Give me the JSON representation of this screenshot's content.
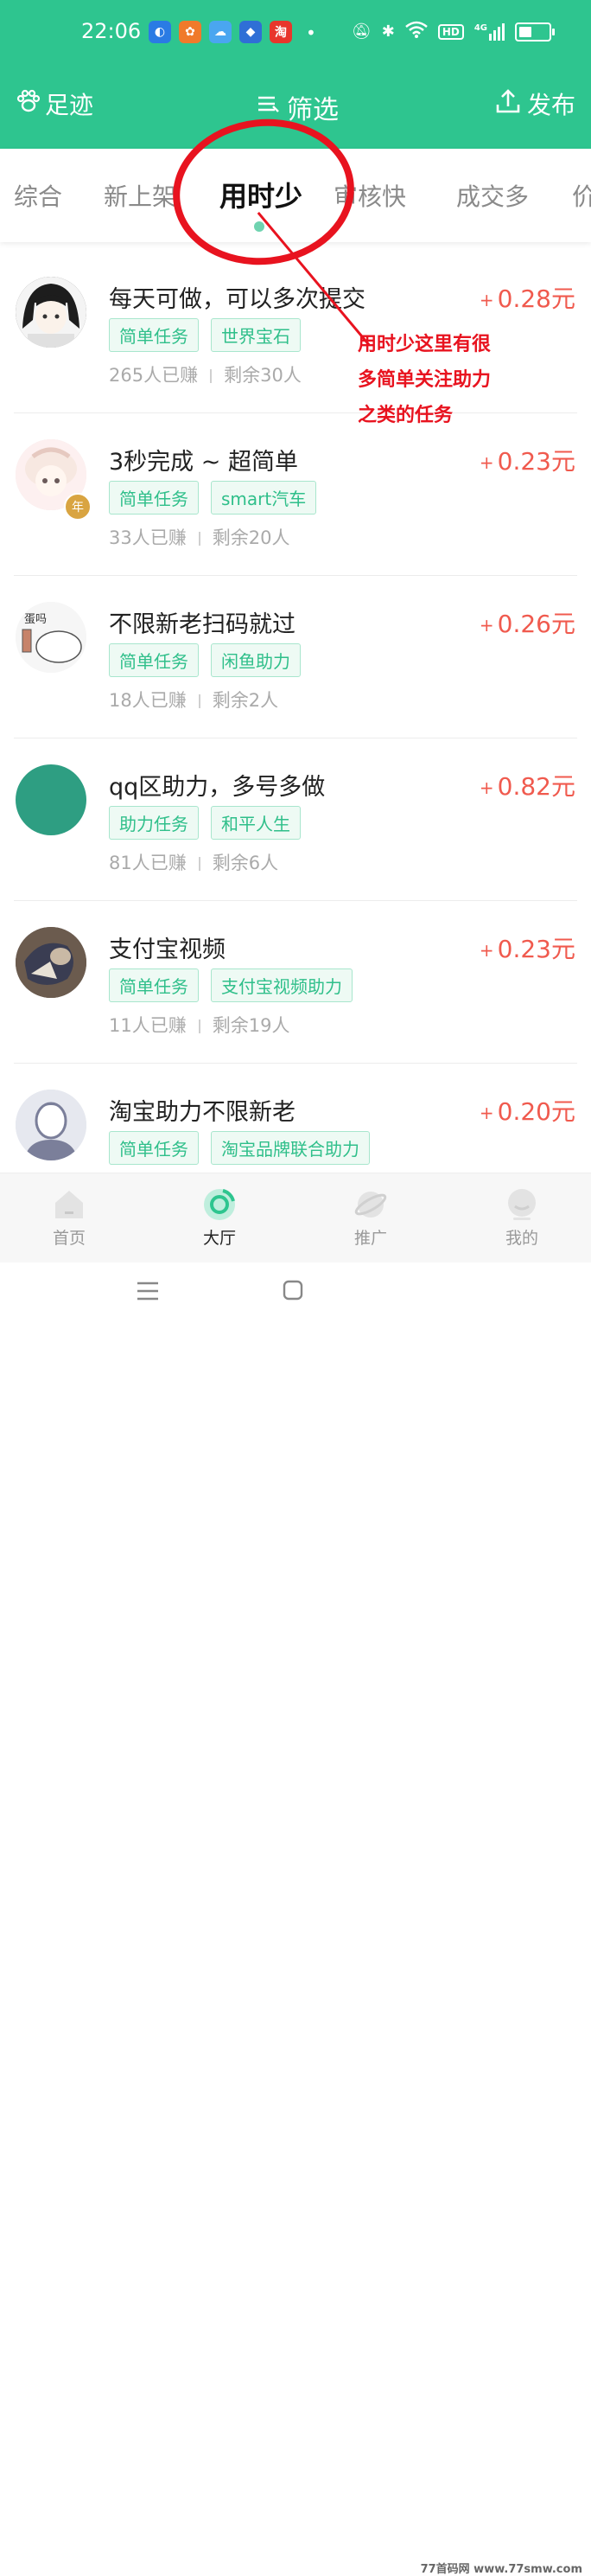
{
  "status_bar": {
    "time": "22:06",
    "app_icons": [
      {
        "name": "browser-app-icon",
        "glyph": "◐",
        "color": "#2a7be4"
      },
      {
        "name": "app2-icon",
        "glyph": "✿",
        "color": "#f07a2b"
      },
      {
        "name": "weather-app-icon",
        "glyph": "☁",
        "color": "#4aa6f0"
      },
      {
        "name": "app4-icon",
        "glyph": "◆",
        "color": "#2f6fd6"
      },
      {
        "name": "taobao-app-icon",
        "glyph": "淘",
        "color": "#e8362c"
      }
    ],
    "dot": "•",
    "hd_label": "HD",
    "network_label": "4G"
  },
  "header": {
    "left_label": "足迹",
    "center_label": "筛选",
    "right_label": "发布"
  },
  "tabs": [
    {
      "label": "综合",
      "active": false
    },
    {
      "label": "新上架",
      "active": false
    },
    {
      "label": "用时少",
      "active": true
    },
    {
      "label": "审核快",
      "active": false
    },
    {
      "label": "成交多",
      "active": false
    },
    {
      "label": "价",
      "active": false
    }
  ],
  "tasks": [
    {
      "title": "每天可做，可以多次提交",
      "price": "0.28元",
      "tags": [
        "简单任务",
        "世界宝石"
      ],
      "earned": "265人已赚",
      "remaining": "剩余30人",
      "avatar_color": "#3b3b3b"
    },
    {
      "title": "3秒完成 ~ 超简单",
      "price": "0.23元",
      "tags": [
        "简单任务",
        "smart汽车"
      ],
      "earned": "33人已赚",
      "remaining": "剩余20人",
      "avatar_color": "#f3dede",
      "badge": "年"
    },
    {
      "title": "不限新老扫码就过",
      "price": "0.26元",
      "tags": [
        "简单任务",
        "闲鱼助力"
      ],
      "earned": "18人已赚",
      "remaining": "剩余2人",
      "avatar_color": "#f4f4f4",
      "avatar_text": "蛋吗"
    },
    {
      "title": "qq区助力，多号多做",
      "price": "0.82元",
      "tags": [
        "助力任务",
        "和平人生"
      ],
      "earned": "81人已赚",
      "remaining": "剩余6人",
      "avatar_color": "#2e9e82"
    },
    {
      "title": "支付宝视频",
      "price": "0.23元",
      "tags": [
        "简单任务",
        "支付宝视频助力"
      ],
      "earned": "11人已赚",
      "remaining": "剩余19人",
      "avatar_color": "#5a4d44"
    },
    {
      "title": "淘宝助力不限新老",
      "price": "0.20元",
      "tags": [
        "简单任务",
        "淘宝品牌联合助力"
      ],
      "earned": "",
      "remaining": "",
      "avatar_color": "#dfe3ec"
    }
  ],
  "price_plus": "+",
  "bottom_nav": [
    {
      "label": "首页",
      "active": false
    },
    {
      "label": "大厅",
      "active": true
    },
    {
      "label": "推广",
      "active": false
    },
    {
      "label": "我的",
      "active": false
    }
  ],
  "annotation": {
    "lines": [
      "用时少这里有很",
      "多简单关注助力",
      "之类的任务"
    ],
    "color": "#e8131f"
  },
  "watermark": "77首码网 www.77smw.com"
}
